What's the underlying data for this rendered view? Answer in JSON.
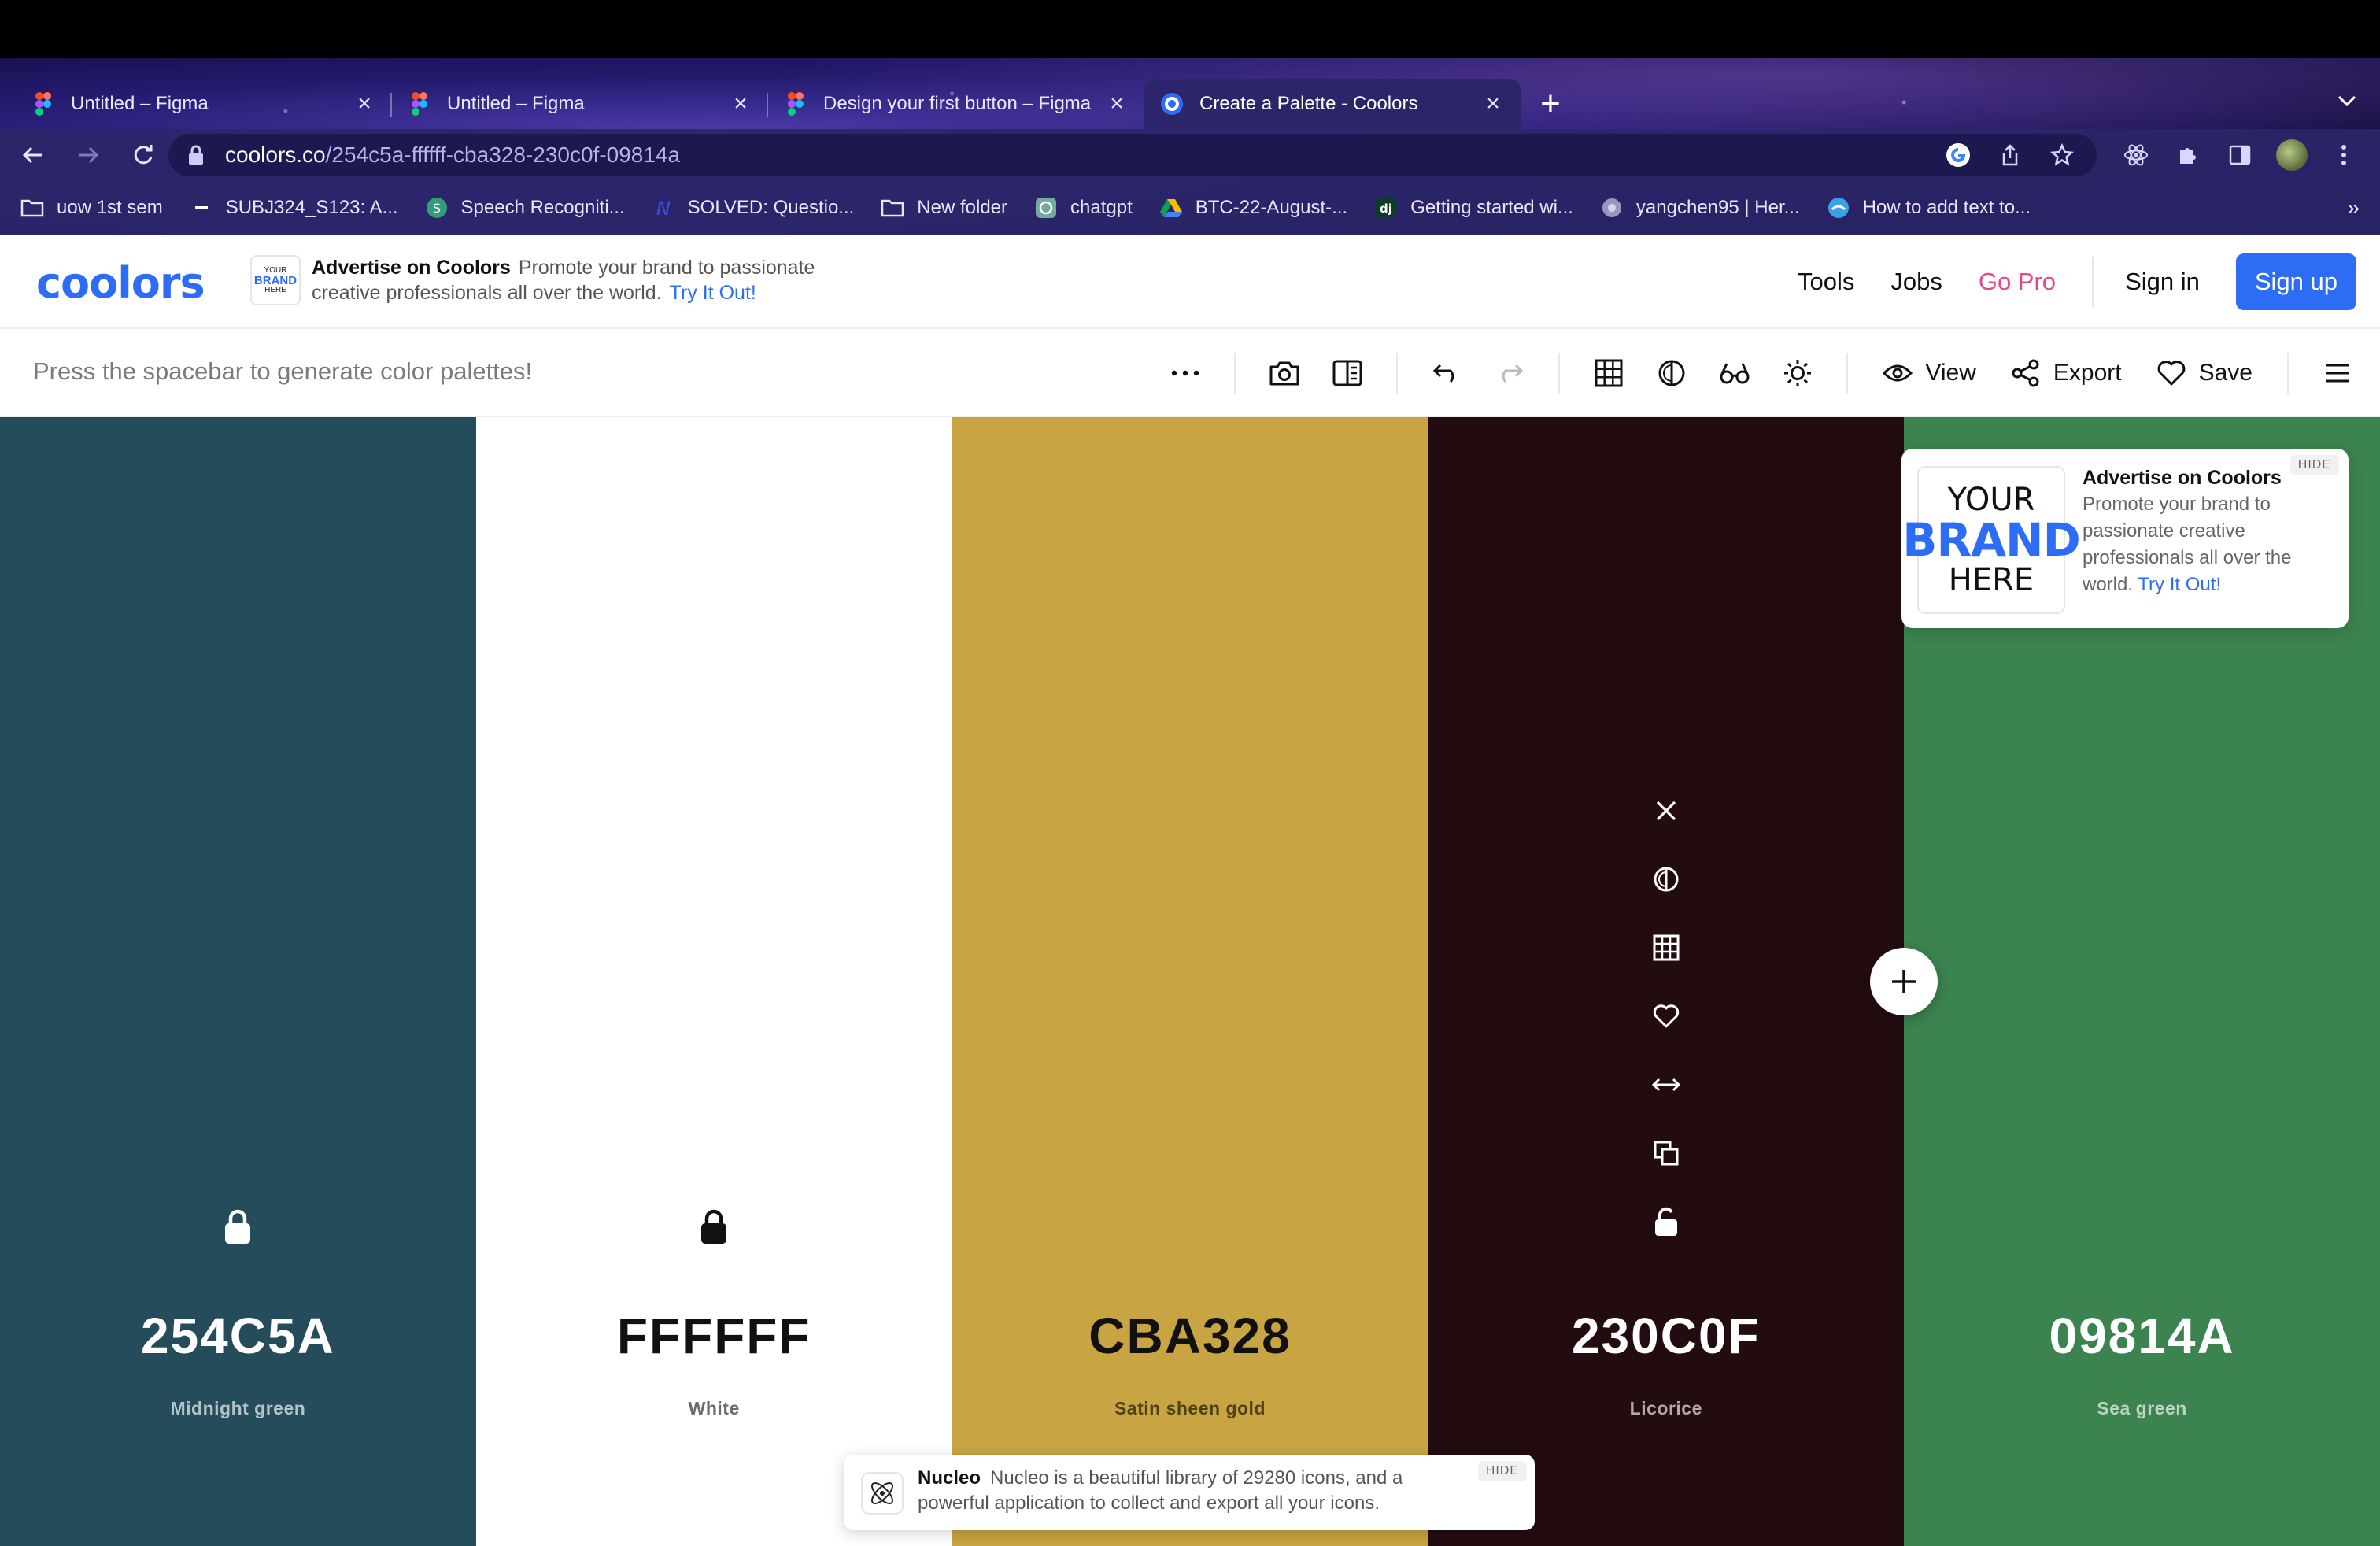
{
  "browser": {
    "tabs": [
      {
        "title": "Untitled – Figma",
        "favicon": "figma-icon",
        "active": false
      },
      {
        "title": "Untitled – Figma",
        "favicon": "figma-icon",
        "active": false
      },
      {
        "title": "Design your first button – Figma",
        "favicon": "figma-icon",
        "active": false
      },
      {
        "title": "Create a Palette - Coolors",
        "favicon": "coolors-icon",
        "active": true
      }
    ],
    "url_host": "coolors.co",
    "url_path": "/254c5a-ffffff-cba328-230c0f-09814a",
    "bookmarks": [
      {
        "label": "uow 1st sem",
        "icon": "folder-icon"
      },
      {
        "label": "SUBJ324_S123: A...",
        "icon": "canvas-icon"
      },
      {
        "label": "Speech Recogniti...",
        "icon": "site-icon"
      },
      {
        "label": "SOLVED: Questio...",
        "icon": "numerade-icon"
      },
      {
        "label": "New folder",
        "icon": "folder-icon"
      },
      {
        "label": "chatgpt",
        "icon": "chatgpt-icon"
      },
      {
        "label": "BTC-22-August-...",
        "icon": "drive-icon"
      },
      {
        "label": "Getting started wi...",
        "icon": "django-icon"
      },
      {
        "label": "yangchen95 | Her...",
        "icon": "site-icon"
      },
      {
        "label": "How to add text to...",
        "icon": "site-icon"
      }
    ],
    "bookmarks_more": "»"
  },
  "header": {
    "logo": "coolors",
    "ad": {
      "thumb_your": "YOUR",
      "thumb_brand": "BRAND",
      "thumb_here": "HERE",
      "title": "Advertise on Coolors",
      "body": "Promote your brand to passionate creative professionals all over the world.",
      "link": "Try It Out!"
    },
    "nav": {
      "tools": "Tools",
      "jobs": "Jobs",
      "pro": "Go Pro",
      "signin": "Sign in",
      "signup": "Sign up"
    }
  },
  "toolbar": {
    "hint": "Press the spacebar to generate color palettes!",
    "view": "View",
    "export": "Export",
    "save": "Save"
  },
  "palette": [
    {
      "hex": "254C5A",
      "name": "Midnight green",
      "bg": "#254C5A",
      "fg": "#FFFFFF",
      "name_color": "#B4C3C8",
      "locked": true
    },
    {
      "hex": "FFFFFF",
      "name": "White",
      "bg": "#FFFFFF",
      "fg": "#111111",
      "name_color": "#6B6B6B",
      "locked": true
    },
    {
      "hex": "CBA328",
      "name": "Satin sheen gold",
      "bg": "#C8A442",
      "fg": "#111111",
      "name_color": "#4F4016",
      "locked": false
    },
    {
      "hex": "230C0F",
      "name": "Licorice",
      "bg": "#230C0F",
      "fg": "#FFFFFF",
      "name_color": "#B3A8A9",
      "locked": false
    },
    {
      "hex": "09814A",
      "name": "Sea green",
      "bg": "#3B834F",
      "fg": "#FFFFFF",
      "name_color": "#BED3C4",
      "locked": false
    }
  ],
  "side_ad": {
    "your": "YOUR",
    "brand": "BRAND",
    "here": "HERE",
    "title": "Advertise on Coolors",
    "body": "Promote your brand to passionate creative professionals all over the world.",
    "link": "Try It Out!",
    "hide": "HIDE"
  },
  "nucleo_ad": {
    "title": "Nucleo",
    "body": "Nucleo is a beautiful library of 29280 icons, and a powerful application to collect and export all your icons.",
    "hide": "HIDE"
  }
}
